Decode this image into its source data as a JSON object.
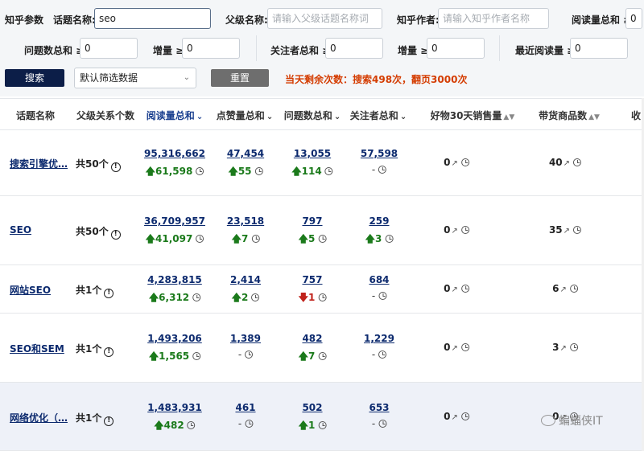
{
  "filters": {
    "row1": {
      "zhihu_params_label": "知乎参数",
      "topic_name_label": "话题名称:",
      "topic_name_value": "seo",
      "parent_name_label": "父级名称:",
      "parent_name_placeholder": "请输入父级话题名称词",
      "author_label": "知乎作者:",
      "author_placeholder": "请输入知乎作者名称",
      "read_total_label": "阅读量总和 ≥",
      "read_total_value": "0"
    },
    "row2": {
      "question_total_label": "问题数总和 ≥",
      "question_total_value": "0",
      "question_increase_label": "增量 ≥",
      "question_increase_value": "0",
      "follower_total_label": "关注者总和 ≥",
      "follower_total_value": "0",
      "follower_increase_label": "增量 ≥",
      "follower_increase_value": "0",
      "recent_read_label": "最近阅读量 ≥",
      "recent_read_value": "0"
    },
    "search_button": "搜索",
    "filter_select": "默认筛选数据",
    "reset_button": "重置",
    "notice": "当天剩余次数：搜索498次，翻页3000次"
  },
  "table": {
    "headers": {
      "topic": "话题名称",
      "parent_count": "父级关系个数",
      "read_total": "阅读量总和",
      "like_total": "点赞量总和",
      "question_total": "问题数总和",
      "follower_total": "关注者总和",
      "goods_30d": "好物30天销售量",
      "goods_count": "带货商品数",
      "extra": "收"
    },
    "rows": [
      {
        "topic": "搜索引擎优…",
        "parent": "共50个",
        "read": "95,316,662",
        "read_delta": "61,598",
        "read_dir": "up",
        "like": "47,454",
        "like_delta": "55",
        "like_dir": "up",
        "question": "13,055",
        "question_delta": "114",
        "question_dir": "up",
        "follower": "57,598",
        "follower_delta": "-",
        "follower_dir": "none",
        "goods30": "0",
        "goods_count": "40"
      },
      {
        "topic": "SEO",
        "parent": "共50个",
        "read": "36,709,957",
        "read_delta": "41,097",
        "read_dir": "up",
        "like": "23,518",
        "like_delta": "7",
        "like_dir": "up",
        "question": "797",
        "question_delta": "5",
        "question_dir": "up",
        "follower": "259",
        "follower_delta": "3",
        "follower_dir": "up",
        "goods30": "0",
        "goods_count": "35"
      },
      {
        "topic": "网站SEO",
        "parent": "共1个",
        "read": "4,283,815",
        "read_delta": "6,312",
        "read_dir": "up",
        "like": "2,414",
        "like_delta": "2",
        "like_dir": "up",
        "question": "757",
        "question_delta": "1",
        "question_dir": "down",
        "follower": "684",
        "follower_delta": "-",
        "follower_dir": "none",
        "goods30": "0",
        "goods_count": "6"
      },
      {
        "topic": "SEO和SEM",
        "parent": "共1个",
        "read": "1,493,206",
        "read_delta": "1,565",
        "read_dir": "up",
        "like": "1,389",
        "like_delta": "-",
        "like_dir": "none",
        "question": "482",
        "question_delta": "7",
        "question_dir": "up",
        "follower": "1,229",
        "follower_delta": "-",
        "follower_dir": "none",
        "goods30": "0",
        "goods_count": "3"
      },
      {
        "topic": "网络优化（…",
        "parent": "共1个",
        "read": "1,483,931",
        "read_delta": "482",
        "read_dir": "up",
        "like": "461",
        "like_delta": "-",
        "like_dir": "none",
        "question": "502",
        "question_delta": "1",
        "question_dir": "up",
        "follower": "653",
        "follower_delta": "-",
        "follower_dir": "none",
        "goods30": "0",
        "goods_count": "0"
      }
    ]
  },
  "watermark": "蝙蝠侠IT"
}
